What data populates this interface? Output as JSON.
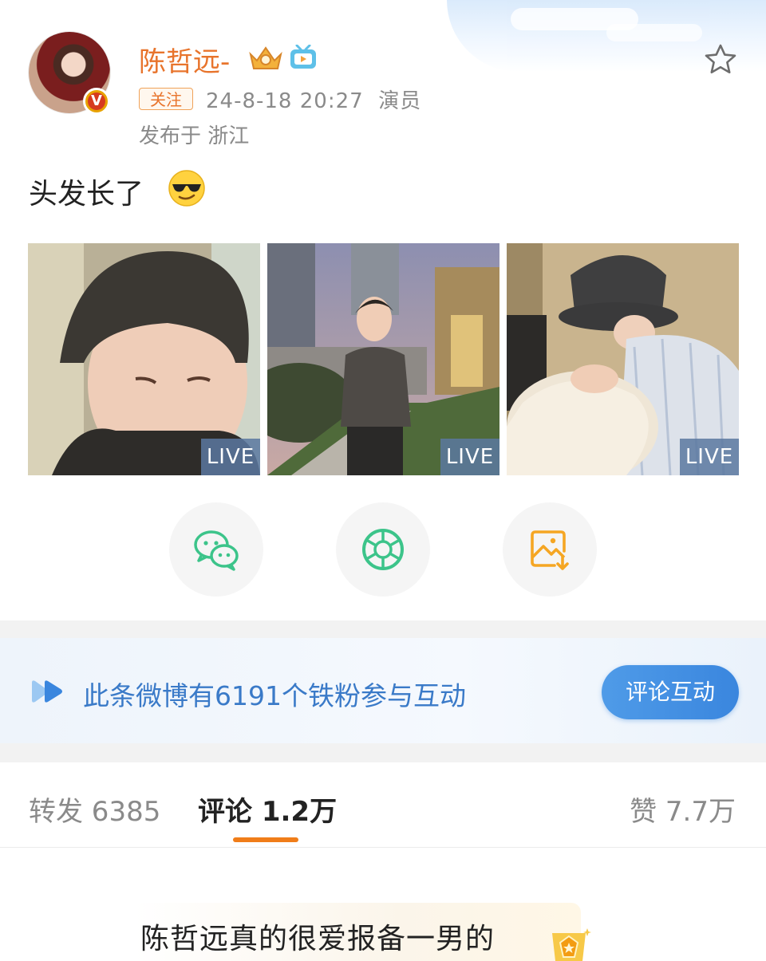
{
  "post": {
    "username": "陈哲远-",
    "follow_label": "关注",
    "timestamp": "24-8-18 20:27",
    "role": "演员",
    "location": "发布于 浙江",
    "text": "头发长了",
    "emoji": "sunglasses-emoji",
    "photos": [
      {
        "live_label": "LIVE"
      },
      {
        "live_label": "LIVE"
      },
      {
        "live_label": "LIVE"
      }
    ]
  },
  "share": {
    "items": [
      "wechat-icon",
      "moments-icon",
      "save-image-icon"
    ]
  },
  "fan_banner": {
    "text": "此条微博有6191个铁粉参与互动",
    "button_label": "评论互动"
  },
  "tabs": {
    "repost": "转发 6385",
    "comment": "评论 1.2万",
    "like": "赞 7.7万"
  },
  "comment": {
    "text": "陈哲远真的很爱报备一男的"
  },
  "colors": {
    "accent_orange": "#f07d19",
    "username": "#e8742c",
    "link_blue": "#3a7ac8",
    "button_blue": "#3a86de"
  }
}
